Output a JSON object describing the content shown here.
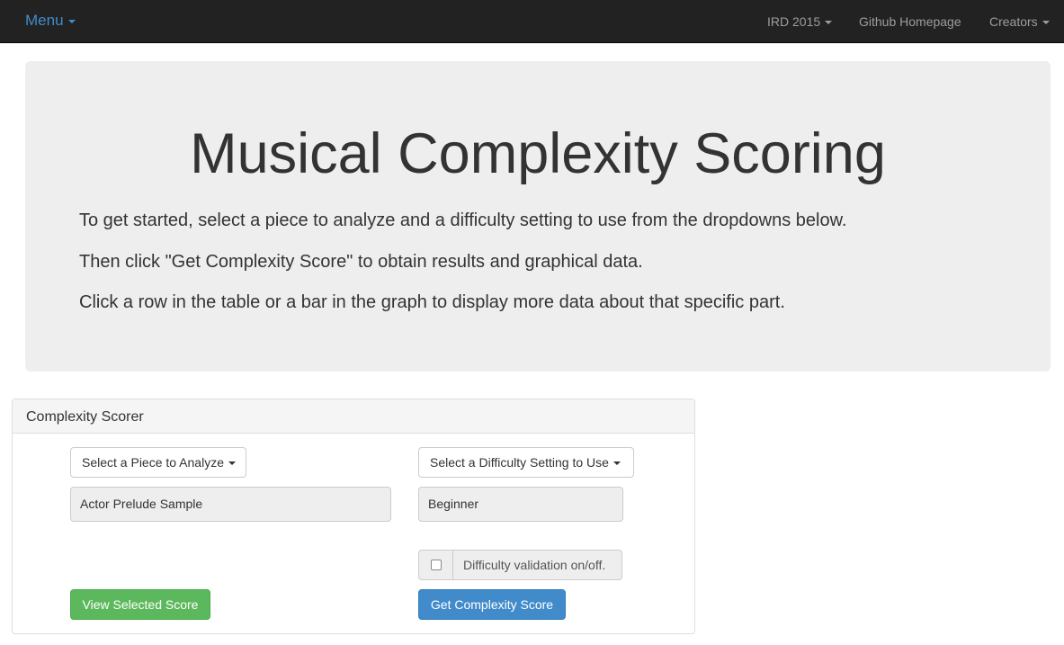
{
  "navbar": {
    "brand": "Menu",
    "items": [
      {
        "label": "IRD 2015",
        "has_caret": true
      },
      {
        "label": "Github Homepage",
        "has_caret": false
      },
      {
        "label": "Creators",
        "has_caret": true
      }
    ]
  },
  "jumbotron": {
    "title": "Musical Complexity Scoring",
    "lines": [
      "To get started, select a piece to analyze and a difficulty setting to use from the dropdowns below.",
      "Then click \"Get Complexity Score\" to obtain results and graphical data.",
      "Click a row in the table or a bar in the graph to display more data about that specific part."
    ]
  },
  "panel": {
    "title": "Complexity Scorer",
    "piece_dropdown_label": "Select a Piece to Analyze",
    "difficulty_dropdown_label": "Select a Difficulty Setting to Use",
    "selected_piece": "Actor Prelude Sample",
    "selected_difficulty": "Beginner",
    "validation_label": "Difficulty validation on/off.",
    "validation_checked": false,
    "view_button": "View Selected Score",
    "get_button": "Get Complexity Score"
  },
  "colors": {
    "navbar_bg": "#222222",
    "brand": "#428bca",
    "jumbotron_bg": "#eeeeee",
    "success": "#5cb85c",
    "primary": "#428bca"
  },
  "icons": [
    "caret-down-icon",
    "checkbox-icon"
  ]
}
